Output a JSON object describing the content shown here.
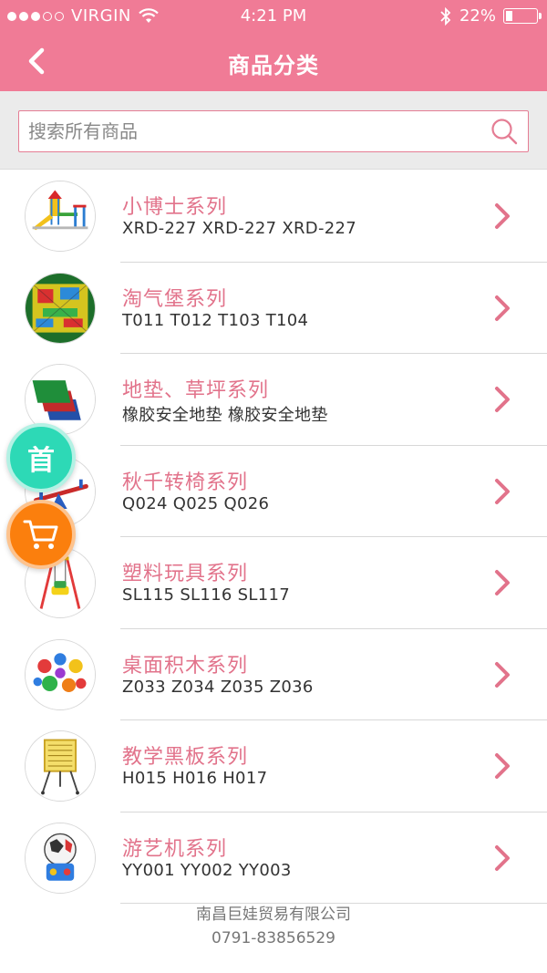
{
  "status": {
    "carrier": "VIRGIN",
    "time": "4:21 PM",
    "battery": "22%"
  },
  "header": {
    "title": "商品分类"
  },
  "search": {
    "placeholder": "搜索所有商品"
  },
  "categories": [
    {
      "title": "小博士系列",
      "subtitle": "XRD-227 XRD-227 XRD-227",
      "thumb": "slide-playground"
    },
    {
      "title": "淘气堡系列",
      "subtitle": "T011 T012 T103 T104",
      "thumb": "indoor-playground"
    },
    {
      "title": "地垫、草坪系列",
      "subtitle": "橡胶安全地垫 橡胶安全地垫",
      "thumb": "rubber-mats"
    },
    {
      "title": "秋千转椅系列",
      "subtitle": "Q024 Q025 Q026",
      "thumb": "seesaw"
    },
    {
      "title": "塑料玩具系列",
      "subtitle": "SL115 SL116 SL117",
      "thumb": "swing"
    },
    {
      "title": "桌面积木系列",
      "subtitle": "Z033 Z034 Z035 Z036",
      "thumb": "building-blocks"
    },
    {
      "title": "教学黑板系列",
      "subtitle": "H015 H016 H017",
      "thumb": "teaching-board"
    },
    {
      "title": "游艺机系列",
      "subtitle": "YY001 YY002 YY003",
      "thumb": "arcade-machine"
    }
  ],
  "floating": {
    "home_label": "首"
  },
  "footer": {
    "company": "南昌巨娃贸易有限公司",
    "phone": "0791-83856529"
  },
  "colors": {
    "brand": "#f07b96",
    "title_pink": "#e2738b",
    "home_fab": "#2dd9b6",
    "cart_fab": "#fb7f0d"
  }
}
